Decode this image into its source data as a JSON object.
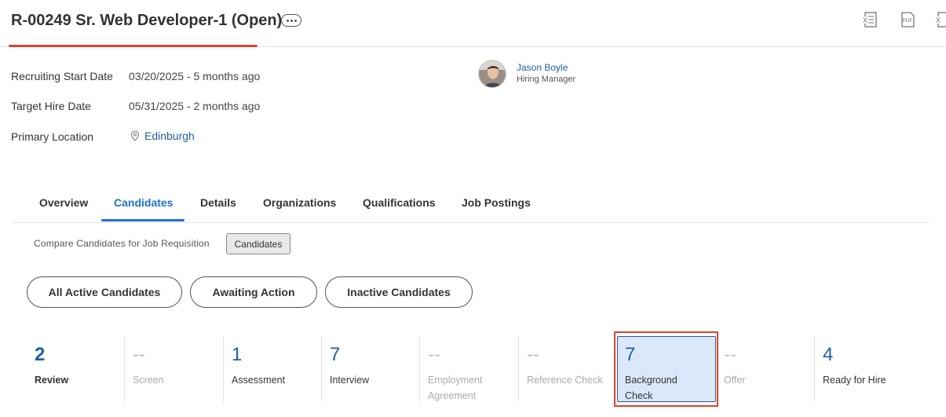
{
  "header": {
    "title": "R-00249 Sr. Web Developer-1 (Open)",
    "more_icon": "more-ellipsis-icon",
    "actions": [
      {
        "name": "export-excel-icon",
        "label": "X"
      },
      {
        "name": "export-pdf-icon",
        "label": "PDF"
      },
      {
        "name": "export-excel-alt-icon",
        "label": "X"
      }
    ]
  },
  "fields": {
    "start_label": "Recruiting Start Date",
    "start_value": "03/20/2025 - 5 months ago",
    "hire_label": "Target Hire Date",
    "hire_value": "05/31/2025 - 2 months ago",
    "location_label": "Primary Location",
    "location_value": "Edinburgh"
  },
  "manager": {
    "name": "Jason Boyle",
    "role": "Hiring Manager"
  },
  "tabs": [
    {
      "label": "Overview"
    },
    {
      "label": "Candidates",
      "active": true
    },
    {
      "label": "Details"
    },
    {
      "label": "Organizations"
    },
    {
      "label": "Qualifications"
    },
    {
      "label": "Job Postings"
    }
  ],
  "subnav": {
    "compare_link": "Compare Candidates for Job Requisition",
    "candidates_chip": "Candidates"
  },
  "filters": [
    {
      "label": "All Active Candidates"
    },
    {
      "label": "Awaiting Action"
    },
    {
      "label": "Inactive Candidates"
    }
  ],
  "stages": [
    {
      "count": "2",
      "label": "Review"
    },
    {
      "count": "--",
      "label": "Screen"
    },
    {
      "count": "1",
      "label": "Assessment"
    },
    {
      "count": "7",
      "label": "Interview"
    },
    {
      "count": "--",
      "label": "Employment Agreement"
    },
    {
      "count": "--",
      "label": "Reference Check"
    },
    {
      "count": "7",
      "label": "Background Check",
      "selected": true
    },
    {
      "count": "--",
      "label": "Offer"
    },
    {
      "count": "4",
      "label": "Ready for Hire"
    }
  ],
  "colors": {
    "accent": "#1f6fd0",
    "link": "#1f5fa8",
    "highlight": "#e0432b",
    "selected_bg": "#dbe8fa"
  }
}
